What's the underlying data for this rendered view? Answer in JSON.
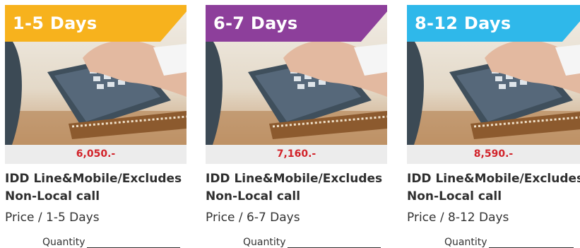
{
  "packages": [
    {
      "ribbon_label": "1-5 Days",
      "ribbon_color": "#f7b21d",
      "price": "6,050.-",
      "title_line1": "IDD Line&Mobile/Excludes",
      "title_line2": "Non-Local call",
      "subtitle": "Price / 1-5 Days",
      "quantity_label": "Quantity",
      "image_icon": "telephone-dialing-photo"
    },
    {
      "ribbon_label": "6-7 Days",
      "ribbon_color": "#8d3f9b",
      "price": "7,160.-",
      "title_line1": "IDD Line&Mobile/Excludes",
      "title_line2": "Non-Local call",
      "subtitle": "Price / 6-7 Days",
      "quantity_label": "Quantity",
      "image_icon": "telephone-dialing-photo"
    },
    {
      "ribbon_label": "8-12 Days",
      "ribbon_color": "#2fb8ea",
      "price": "8,590.-",
      "title_line1": "IDD Line&Mobile/Excludes",
      "title_line2": "Non-Local call",
      "subtitle": "Price / 8-12 Days",
      "quantity_label": "Quantity",
      "image_icon": "telephone-dialing-photo"
    }
  ]
}
